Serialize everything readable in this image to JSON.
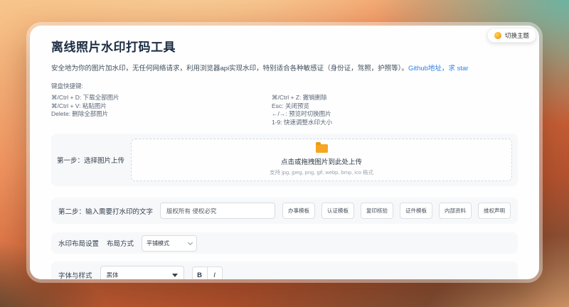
{
  "theme_toggle": {
    "icon": "sun-icon",
    "label": "切换主题"
  },
  "header": {
    "title": "离线照片水印打码工具",
    "description": "安全地为你的图片加水印，无任何网络请求，利用浏览器api实现水印，特别适合各种敏感证（身份证，驾照，护照等）。",
    "github_link": "Github地址，求 star"
  },
  "shortcuts": {
    "heading": "键盘快捷键:",
    "left": [
      "⌘/Ctrl + D: 下载全部图片",
      "⌘/Ctrl + V: 粘贴图片",
      "Delete: 删除全部图片"
    ],
    "right": [
      "⌘/Ctrl + Z: 撤销删除",
      "Esc: 关闭预览",
      "←/→: 预览时切换图片",
      "1-9: 快速调整水印大小"
    ]
  },
  "step1": {
    "label": "第一步：选择图片上传",
    "upload_icon": "folder-icon",
    "upload_text": "点击或拖拽图片到此处上传",
    "upload_hint": "支持 jpg, jpeg, png, gif, webp, bmp, ico 格式"
  },
  "step2": {
    "label": "第二步：输入需要打水印的文字",
    "input_value": "版权所有 侵权必究",
    "templates": [
      "办事模板",
      "认证模板",
      "复印核验",
      "证件模板",
      "内部资料",
      "维权声明"
    ]
  },
  "layout_section": {
    "label": "水印布局设置",
    "mode_label": "布局方式",
    "mode_value": "平铺模式"
  },
  "font_section": {
    "label": "字体与样式",
    "font_value": "黑体",
    "bold_label": "B",
    "italic_label": "I"
  },
  "colors": {
    "link_blue": "#2e7ee6",
    "folder_orange": "#f6a623",
    "row_background": "#f7f8fa"
  }
}
